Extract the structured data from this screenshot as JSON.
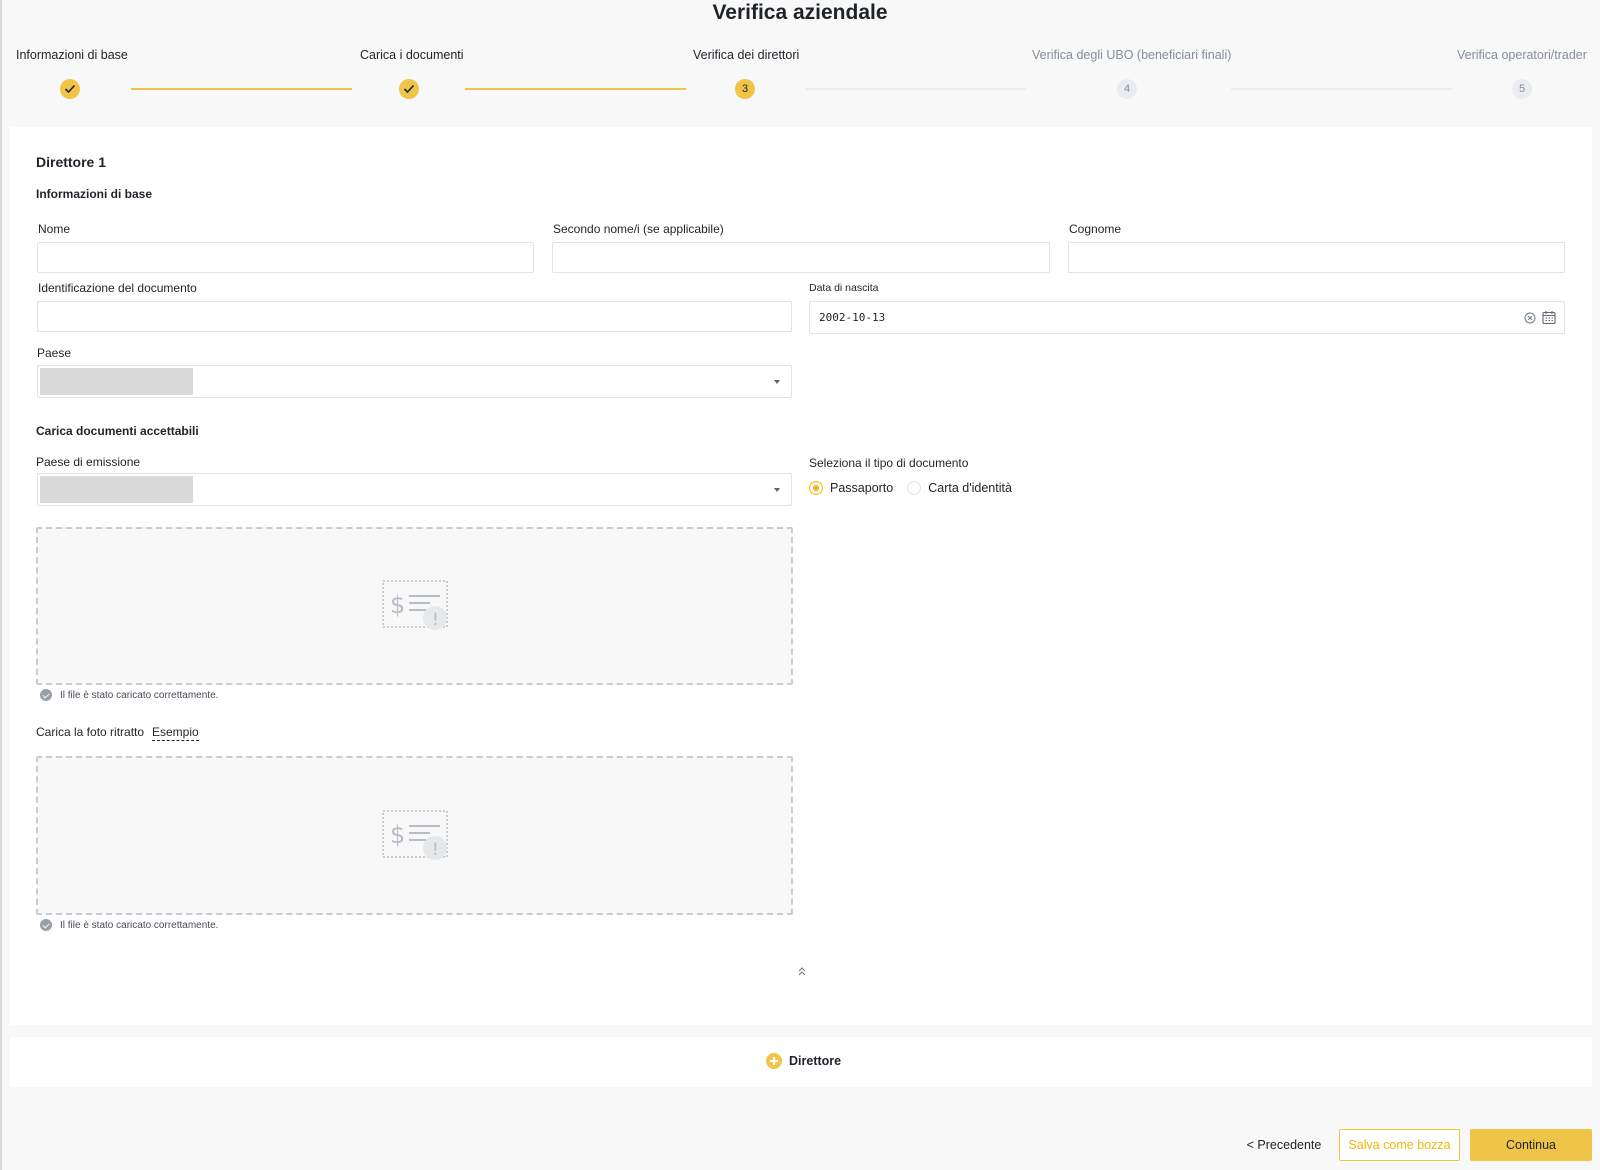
{
  "page": {
    "title": "Verifica aziendale"
  },
  "stepper": {
    "steps": [
      {
        "label": "Informazioni di base",
        "status": "done",
        "number": ""
      },
      {
        "label": "Carica i documenti",
        "status": "done",
        "number": ""
      },
      {
        "label": "Verifica dei direttori",
        "status": "active",
        "number": "3"
      },
      {
        "label": "Verifica degli UBO (beneficiari finali)",
        "status": "todo",
        "number": "4"
      },
      {
        "label": "Verifica operatori/trader",
        "status": "todo",
        "number": "5"
      }
    ]
  },
  "director": {
    "title": "Direttore 1",
    "basic_info_heading": "Informazioni di base",
    "first_name": {
      "label": "Nome",
      "value": ""
    },
    "middle_name": {
      "label": "Secondo nome/i (se applicabile)",
      "value": ""
    },
    "last_name": {
      "label": "Cognome",
      "value": ""
    },
    "document_id": {
      "label": "Identificazione del documento",
      "value": ""
    },
    "birth_date": {
      "label": "Data di nascita",
      "value": "2002-10-13"
    },
    "country": {
      "label": "Paese"
    },
    "documents_heading": "Carica documenti accettabili",
    "issuing_country": {
      "label": "Paese di emissione"
    },
    "document_type": {
      "label": "Seleziona il tipo di documento",
      "options": [
        {
          "label": "Passaporto",
          "checked": true
        },
        {
          "label": "Carta d'identità",
          "checked": false
        }
      ]
    },
    "document_upload": {
      "success": "Il file è stato caricato correttamente."
    },
    "portrait_upload": {
      "label": "Carica la foto ritratto",
      "example_link": "Esempio",
      "success": "Il file è stato caricato correttamente."
    }
  },
  "add_director": {
    "label": "Direttore"
  },
  "footer": {
    "prev_label": "< Precedente",
    "draft_label": "Salva come bozza",
    "continue_label": "Continua"
  },
  "colors": {
    "accent": "#f0c447",
    "accent_text": "#f0b90b",
    "border": "#e0e3e7"
  },
  "icons": {
    "step_done": "check-icon",
    "date_clear": "clear-icon",
    "date_picker": "calendar-icon",
    "select": "chevron-down-icon",
    "upload": "document-upload-icon",
    "success": "check-circle-icon",
    "collapse": "double-chevron-up-icon",
    "add": "plus-circle-icon"
  }
}
